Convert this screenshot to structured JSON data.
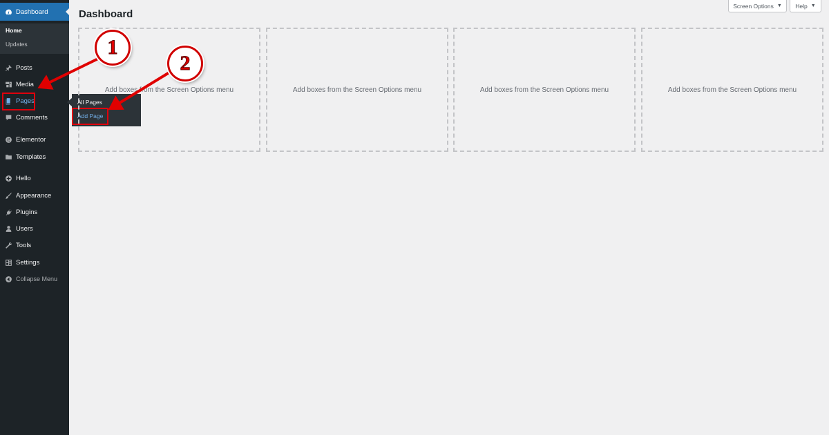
{
  "header": {
    "title": "Dashboard",
    "screen_options_label": "Screen Options",
    "help_label": "Help",
    "caret": "▼"
  },
  "sidebar": {
    "dashboard_label": "Dashboard",
    "dashboard_sub": [
      "Home",
      "Updates"
    ],
    "items": [
      {
        "label": "Posts",
        "icon": "pin-icon"
      },
      {
        "label": "Media",
        "icon": "media-icon"
      },
      {
        "label": "Pages",
        "icon": "pages-icon"
      },
      {
        "label": "Comments",
        "icon": "comments-icon"
      },
      {
        "label": "Elementor",
        "icon": "elementor-icon"
      },
      {
        "label": "Templates",
        "icon": "folder-icon"
      },
      {
        "label": "Hello",
        "icon": "plus-circle-icon"
      },
      {
        "label": "Appearance",
        "icon": "brush-icon"
      },
      {
        "label": "Plugins",
        "icon": "plug-icon"
      },
      {
        "label": "Users",
        "icon": "users-icon"
      },
      {
        "label": "Tools",
        "icon": "wrench-icon"
      },
      {
        "label": "Settings",
        "icon": "settings-icon"
      },
      {
        "label": "Collapse Menu",
        "icon": "collapse-icon"
      }
    ]
  },
  "flyout": {
    "items": [
      "All Pages",
      "Add Page"
    ]
  },
  "boxes": [
    "Add boxes from the Screen Options menu",
    "Add boxes from the Screen Options menu",
    "Add boxes from the Screen Options menu",
    "Add boxes from the Screen Options menu"
  ],
  "annotations": {
    "step1": "1",
    "step2": "2"
  },
  "colors": {
    "sidebar": "#1d2327",
    "accent": "#2271b1",
    "highlight": "#e0000c"
  }
}
